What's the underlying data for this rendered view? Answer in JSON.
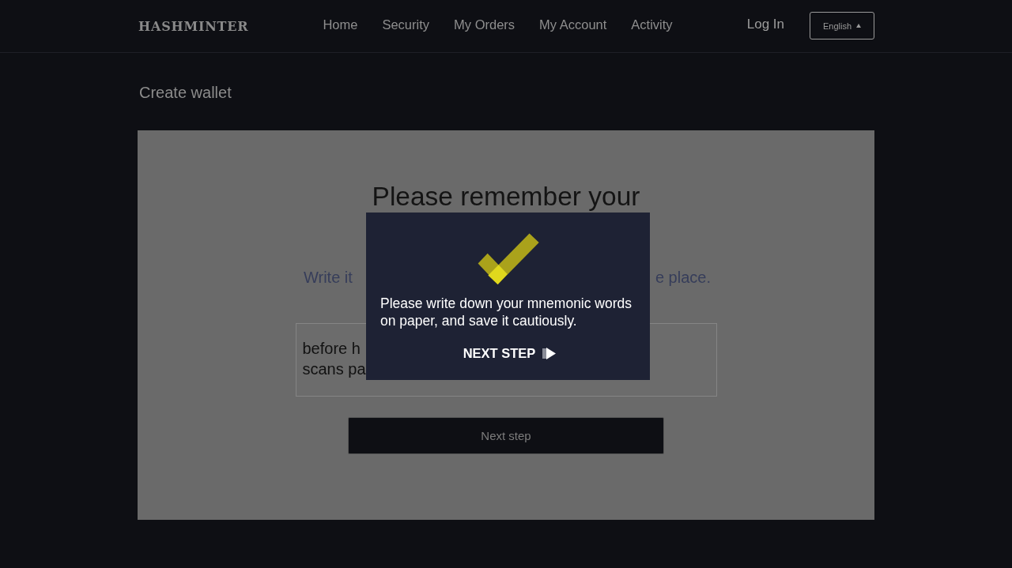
{
  "header": {
    "logo": "HASHMINTER",
    "nav": [
      "Home",
      "Security",
      "My Orders",
      "My Account",
      "Activity"
    ],
    "login": "Log In",
    "language": "English"
  },
  "page_title": "Create wallet",
  "card": {
    "heading": "Please remember your",
    "instruction_parts": [
      "Write it",
      "e place."
    ],
    "mnemonic_lines": [
      "before h",
      "scans pa"
    ],
    "button": "Next step"
  },
  "modal": {
    "message": "Please write down your mnemonic words on paper, and save it cautiously.",
    "button": "NEXT STEP"
  }
}
